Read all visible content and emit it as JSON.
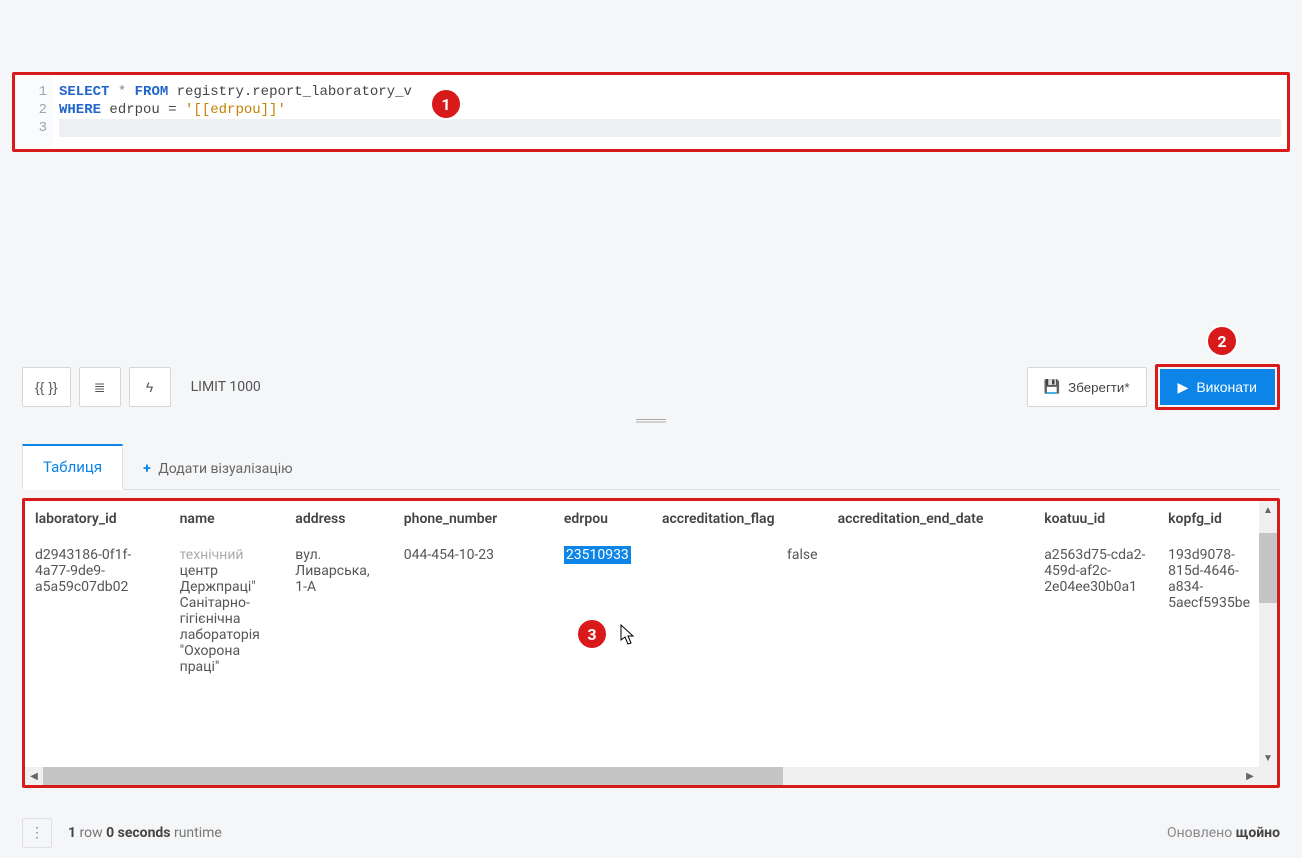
{
  "callouts": {
    "one": "1",
    "two": "2",
    "three": "3"
  },
  "editor": {
    "gutter": [
      "1",
      "2",
      "3"
    ],
    "line1": {
      "select": "SELECT",
      "star": " * ",
      "from": "FROM",
      "table": " registry.report_laboratory_v"
    },
    "line2": {
      "where": "WHERE",
      "cond": " edrpou = ",
      "param": "'[[edrpou]]'"
    },
    "line3": ""
  },
  "toolbar": {
    "brackets": "{{ }}",
    "indent_icon": "≣",
    "format_icon": "ϟ",
    "limit_label": "LIMIT 1000",
    "save_label": "Зберегти*",
    "execute_label": "Виконати"
  },
  "drag_handle": "═══",
  "tabs": {
    "table_label": "Таблиця",
    "add_plus": "+",
    "add_label": "Додати візуалізацію"
  },
  "table": {
    "headers": {
      "laboratory_id": "laboratory_id",
      "name": "name",
      "address": "address",
      "phone_number": "phone_number",
      "edrpou": "edrpou",
      "accreditation_flag": "accreditation_flag",
      "accreditation_end_date": "accreditation_end_date",
      "koatuu_id": "koatuu_id",
      "kopfg_id": "kopfg_id"
    },
    "row": {
      "laboratory_id": "d2943186-0f1f-4a77-9de9-a5a59c07db02",
      "name_faded": "технічний",
      "name_rest": "центр Держпраці\" Санітарно-гігієнічна лабораторія \"Охорона праці\"",
      "address": "вул. Ливарська, 1-А",
      "phone_number": "044-454-10-23",
      "edrpou": "23510933",
      "accreditation_flag": "false",
      "accreditation_end_date": "",
      "koatuu_id": "a2563d75-cda2-459d-af2c-2e04ee30b0a1",
      "kopfg_id": "193d9078-815d-4646-a834-5aecf5935be"
    }
  },
  "status": {
    "rows_part1": "1",
    "rows_part2": " row ",
    "runtime_part1": "0 seconds",
    "runtime_part2": " runtime",
    "refresh_label1": "Оновлено ",
    "refresh_label2": "щойно"
  }
}
